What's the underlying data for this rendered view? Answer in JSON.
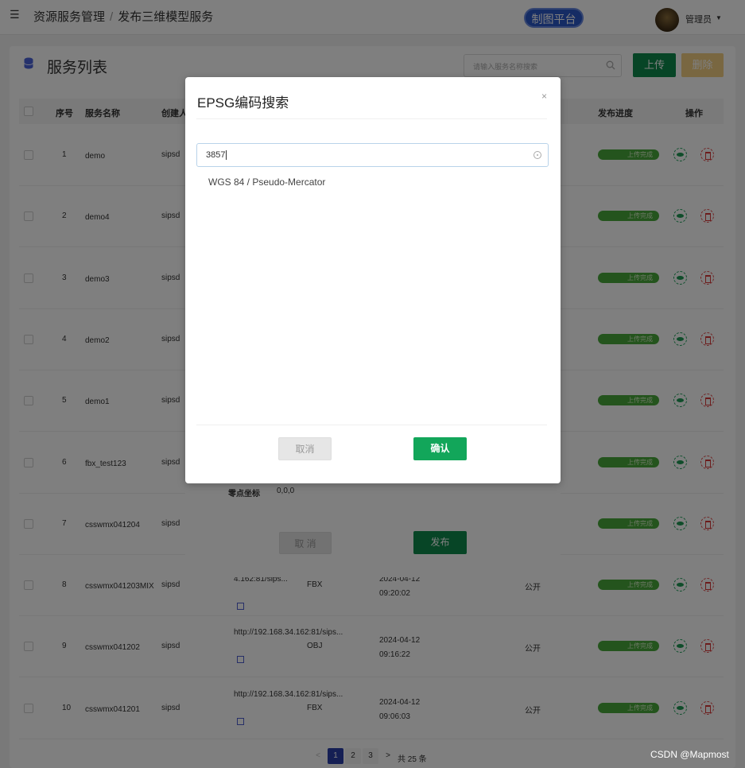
{
  "header": {
    "breadcrumb": [
      "资源服务管理",
      "发布三维模型服务"
    ],
    "separator": "/",
    "platform_button": "制图平台",
    "user_name": "管理员"
  },
  "panel": {
    "title": "服务列表",
    "search_placeholder": "请输入服务名称搜索",
    "upload_label": "上传",
    "delete_label": "删除"
  },
  "table": {
    "columns": [
      "序号",
      "服务名称",
      "创建人",
      "发布进度",
      "操作"
    ],
    "rows": [
      {
        "idx": "1",
        "name": "demo",
        "creator": "sipsd",
        "url": "",
        "format": "",
        "time": "",
        "public": "",
        "status": "上传完成"
      },
      {
        "idx": "2",
        "name": "demo4",
        "creator": "sipsd",
        "url": "",
        "format": "",
        "time": "",
        "public": "",
        "status": "上传完成"
      },
      {
        "idx": "3",
        "name": "demo3",
        "creator": "sipsd",
        "url": "",
        "format": "",
        "time": "",
        "public": "",
        "status": "上传完成"
      },
      {
        "idx": "4",
        "name": "demo2",
        "creator": "sipsd",
        "url": "",
        "format": "",
        "time": "",
        "public": "",
        "status": "上传完成"
      },
      {
        "idx": "5",
        "name": "demo1",
        "creator": "sipsd",
        "url": "",
        "format": "",
        "time": "",
        "public": "",
        "status": "上传完成"
      },
      {
        "idx": "6",
        "name": "fbx_test123",
        "creator": "sipsd",
        "url": "",
        "format": "",
        "time": "",
        "public": "",
        "status": "上传完成"
      },
      {
        "idx": "7",
        "name": "csswmx041204",
        "creator": "sipsd",
        "url": "",
        "format": "",
        "time": "",
        "public": "",
        "status": "上传完成"
      },
      {
        "idx": "8",
        "name": "csswmx041203MIX",
        "creator": "sipsd",
        "url": "4.162:81/sips...",
        "format": "FBX",
        "time": "2024-04-12 09:20:02",
        "public": "公开",
        "status": "上传完成"
      },
      {
        "idx": "9",
        "name": "csswmx041202",
        "creator": "sipsd",
        "url": "http://192.168.34.162:81/sips...",
        "format": "OBJ",
        "time": "2024-04-12 09:16:22",
        "public": "公开",
        "status": "上传完成"
      },
      {
        "idx": "10",
        "name": "csswmx041201",
        "creator": "sipsd",
        "url": "http://192.168.34.162:81/sips...",
        "format": "FBX",
        "time": "2024-04-12 09:06:03",
        "public": "公开",
        "status": "上传完成"
      }
    ]
  },
  "pager": {
    "pages": [
      "1",
      "2",
      "3"
    ],
    "active": "1",
    "prev": "<",
    "next": ">",
    "total": "共 25 条"
  },
  "under_dialog": {
    "origin_label": "零点坐标",
    "origin_value": "0,0,0",
    "cancel_label": "取 消",
    "publish_label": "发布"
  },
  "modal": {
    "title": "EPSG编码搜索",
    "close": "×",
    "input_value": "3857",
    "results": [
      "WGS 84 / Pseudo-Mercator"
    ],
    "cancel_label": "取消",
    "confirm_label": "确认"
  },
  "watermark": "CSDN @Mapmost",
  "colors": {
    "primary_green": "#0e8a4c",
    "confirm_green": "#12a65a",
    "platform_blue": "#2a58c8",
    "status_green": "#48a83a",
    "delete_yellow": "#f3cf82"
  }
}
